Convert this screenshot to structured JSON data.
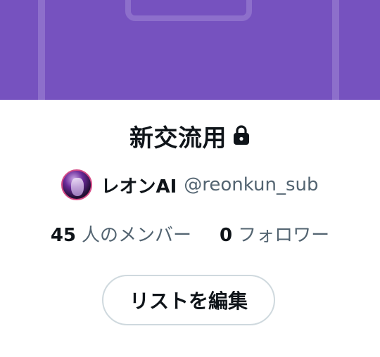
{
  "list": {
    "title": "新交流用",
    "locked_icon": "lock-icon",
    "owner": {
      "name": "レオンAI",
      "handle": "@reonkun_sub",
      "avatar_icon": "avatar"
    },
    "stats": {
      "members_count": "45",
      "members_label": "人のメンバー",
      "followers_count": "0",
      "followers_label": "フォロワー"
    },
    "edit_button_label": "リストを編集"
  },
  "colors": {
    "banner": "#7652bf",
    "text_primary": "#0f1419",
    "text_secondary": "#536471",
    "button_border": "#cfd9de"
  }
}
